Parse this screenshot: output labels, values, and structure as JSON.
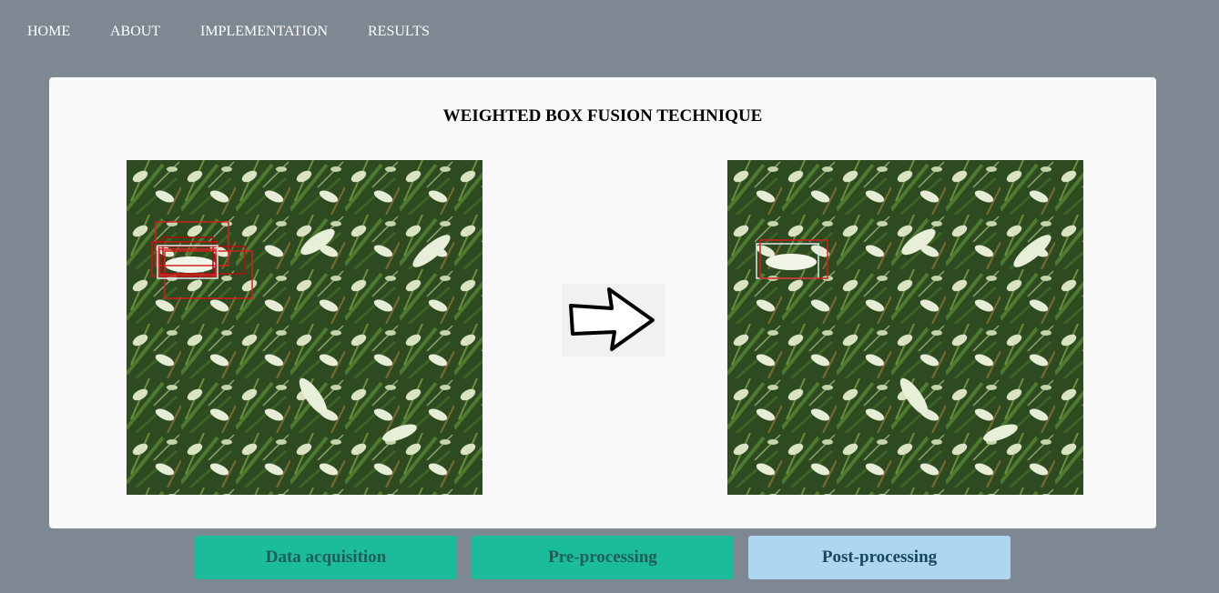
{
  "nav": {
    "items": [
      {
        "label": "HOME"
      },
      {
        "label": "ABOUT"
      },
      {
        "label": "IMPLEMENTATION"
      },
      {
        "label": "RESULTS"
      }
    ]
  },
  "main": {
    "title": "WEIGHTED BOX FUSION TECHNIQUE",
    "images": [
      {
        "name": "wheat-field-multiple-boxes"
      },
      {
        "name": "wheat-field-fused-box"
      }
    ],
    "arrow_icon": "right-arrow-icon"
  },
  "tabs": [
    {
      "label": "Data acquisition",
      "state": "default"
    },
    {
      "label": "Pre-processing",
      "state": "default"
    },
    {
      "label": "Post-processing",
      "state": "active"
    }
  ],
  "colors": {
    "page_bg": "#7e8893",
    "card_bg": "#f9f9f9",
    "tab_green": "#1abc9c",
    "tab_active": "#aed6f1",
    "box_red": "#d11f1f"
  }
}
